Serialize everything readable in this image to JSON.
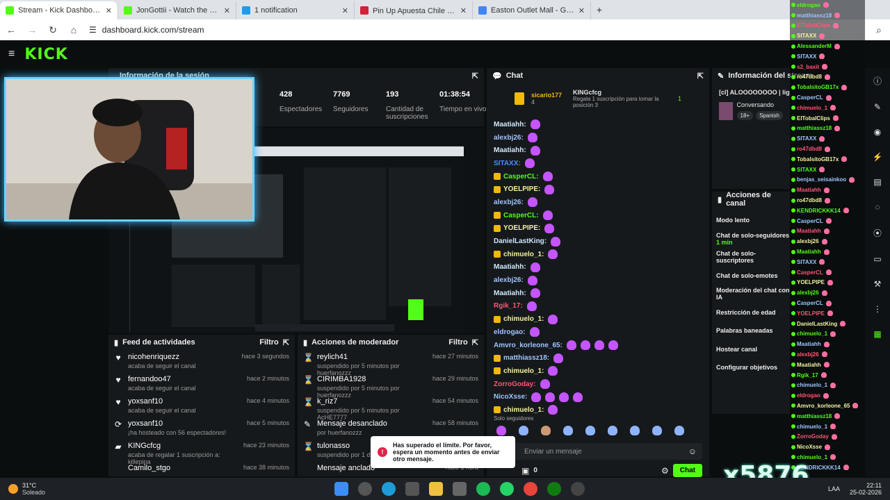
{
  "tabs": [
    {
      "title": "Stream - Kick Dashboard",
      "color": "#53fc18"
    },
    {
      "title": "JonGottii - Watch the VOD on K",
      "color": "#53fc18"
    },
    {
      "title": "1 notification",
      "color": "#1d9bf0"
    },
    {
      "title": "Pin Up Apuesta Chile ➤ Libro D",
      "color": "#d0223b"
    },
    {
      "title": "Easton Outlet Mall - Google Ma",
      "color": "#4285f4"
    }
  ],
  "url": "dashboard.kick.com/stream",
  "session": {
    "title": "Información de la sesión",
    "stats": [
      {
        "value": "428",
        "label": "Espectadores"
      },
      {
        "value": "7769",
        "label": "Seguidores"
      },
      {
        "value": "193",
        "label": "Cantidad de suscripciones"
      },
      {
        "value": "01:38:54",
        "label": "Tiempo en vivo"
      }
    ]
  },
  "feed": {
    "title": "Feed de actividades",
    "filter": "Filtro",
    "items": [
      {
        "icon": "♥",
        "name": "nicohenriquezz",
        "sub": "acaba de seguir el canal",
        "time": "hace 3 segundos"
      },
      {
        "icon": "♥",
        "name": "fernandoo47",
        "sub": "acaba de seguir el canal",
        "time": "hace 2 minutos"
      },
      {
        "icon": "♥",
        "name": "yoxsanf10",
        "sub": "acaba de seguir el canal",
        "time": "hace 4 minutos"
      },
      {
        "icon": "⟳",
        "name": "yoxsanf10",
        "sub": "¡ha hosteado con 56 espectadores!",
        "time": "hace 5 minutos"
      },
      {
        "icon": "▰",
        "name": "KINGcfcg",
        "sub": "acaba de regalar 1 suscripción a: killepipa",
        "time": "hace 23 minutos"
      },
      {
        "icon": "",
        "name": "Camilo_stgo",
        "sub": "",
        "time": "hace 38 minutos"
      }
    ]
  },
  "mod": {
    "title": "Acciones de moderador",
    "filter": "Filtro",
    "items": [
      {
        "icon": "⌛",
        "name": "reylich41",
        "sub": "suspendido por 5 minutos por huerfanozzz",
        "time": "hace 27 minutos"
      },
      {
        "icon": "⌛",
        "name": "CIRIMBA1928",
        "sub": "suspendido por 5 minutos por huerfanozzz",
        "time": "hace 29 minutos"
      },
      {
        "icon": "⌛",
        "name": "k_riz7",
        "sub": "suspendido por 5 minutos por AcHE7777",
        "time": "hace 54 minutos"
      },
      {
        "icon": "✎",
        "name": "Mensaje desanclado",
        "sub": "por huerfanozzz",
        "time": "hace 58 minutos"
      },
      {
        "icon": "⌛",
        "name": "tulonasso",
        "sub": "suspendido por 1 día p",
        "time": ""
      },
      {
        "icon": "",
        "name": "Mensaje anclado",
        "sub": "",
        "time": "hace 1 hora"
      }
    ]
  },
  "chat": {
    "title": "Chat",
    "pinned_user": "sicario177",
    "pinned_count": "4",
    "gift_user": "KINGcfcg",
    "gift_text": "Regala 1 suscripción para tomar la posición 3",
    "gift_num": "1",
    "messages": [
      {
        "user": "Maatiahh:",
        "color": "#cfe8ff",
        "badge": false,
        "emotes": 1
      },
      {
        "user": "alexbj26:",
        "color": "#9ec5ff",
        "badge": false,
        "emotes": 1
      },
      {
        "user": "Maatiahh:",
        "color": "#cfe8ff",
        "badge": false,
        "emotes": 1
      },
      {
        "user": "SITAXX:",
        "color": "#4d8cff",
        "badge": false,
        "emotes": 1
      },
      {
        "user": "CasperCL:",
        "color": "#53fc18",
        "badge": true,
        "emotes": 1
      },
      {
        "user": "YOELPIPE:",
        "color": "#f2f2a0",
        "badge": true,
        "emotes": 1
      },
      {
        "user": "alexbj26:",
        "color": "#9ec5ff",
        "badge": false,
        "emotes": 1
      },
      {
        "user": "CasperCL:",
        "color": "#53fc18",
        "badge": true,
        "emotes": 1
      },
      {
        "user": "YOELPIPE:",
        "color": "#f2f2a0",
        "badge": true,
        "emotes": 1
      },
      {
        "user": "DanielLastKing:",
        "color": "#cfe8ff",
        "badge": false,
        "emotes": 1
      },
      {
        "user": "chimuelo_1:",
        "color": "#f2f2a0",
        "badge": true,
        "emotes": 1
      },
      {
        "user": "Maatiahh:",
        "color": "#cfe8ff",
        "badge": false,
        "emotes": 1
      },
      {
        "user": "alexbj26:",
        "color": "#9ec5ff",
        "badge": false,
        "emotes": 1
      },
      {
        "user": "Maatiahh:",
        "color": "#cfe8ff",
        "badge": false,
        "emotes": 1
      },
      {
        "user": "Rgik_17:",
        "color": "#ff5577",
        "badge": false,
        "emotes": 1
      },
      {
        "user": "chimuelo_1:",
        "color": "#f2f2a0",
        "badge": true,
        "emotes": 1
      },
      {
        "user": "eldrogao:",
        "color": "#9ec5ff",
        "badge": false,
        "emotes": 1
      },
      {
        "user": "Amvro_korleone_65:",
        "color": "#9ec5ff",
        "badge": false,
        "emotes": 4
      },
      {
        "user": "matthiassz18:",
        "color": "#9ec5ff",
        "badge": true,
        "emotes": 1
      },
      {
        "user": "chimuelo_1:",
        "color": "#f2f2a0",
        "badge": true,
        "emotes": 1
      },
      {
        "user": "ZorroGoday:",
        "color": "#ff5577",
        "badge": false,
        "emotes": 1
      },
      {
        "user": "NicoXsse:",
        "color": "#9ec5ff",
        "badge": false,
        "emotes": 4
      },
      {
        "user": "chimuelo_1:",
        "color": "#f2f2a0",
        "badge": true,
        "emotes": 1
      }
    ],
    "followers_only": "Solo seguidores",
    "input_placeholder": "Enviar un mensaje",
    "points": "0",
    "send": "Chat"
  },
  "stream_info": {
    "title": "Información del stream",
    "stream_title": "[cl] ALOOOOOOOO | lig lds",
    "category": "Conversando",
    "tags": [
      "18+",
      "Spanish"
    ]
  },
  "actions": {
    "title": "Acciones de canal",
    "items": [
      "Modo lento",
      "Chat de solo-seguidores",
      "Chat de solo-suscriptores",
      "Chat de solo-emotes",
      "Moderación del chat con IA",
      "Restricción de edad",
      "Palabras baneadas",
      "Hostear canal",
      "Configurar objetivos"
    ],
    "followers_sub": "1 min"
  },
  "toast": "Has superado el límite. Por favor, espera un momento antes de enviar otro mensaje.",
  "overlay_users": [
    "eldrogao",
    "matthiassz18",
    "ElTobalClips",
    "SITAXX",
    "AlessanderM",
    "SITAXX",
    "s2_baxit",
    "ro47dbd8",
    "TobalsitoGB17x",
    "CasperCL",
    "chimuelo_1",
    "ElTobalClips",
    "matthiassz18",
    "SITAXX",
    "ro47dbd8",
    "TobalsitoGB17x",
    "SITAXX",
    "benjas_seisainkoo",
    "Maatiahh",
    "ro47dbd8",
    "KENDRICKKK14",
    "CasperCL",
    "Maatiahh",
    "alexbj26",
    "Maatiahh",
    "SITAXX",
    "CasperCL",
    "YOELPIPE",
    "alexbj26",
    "CasperCL",
    "YOELPIPE",
    "DanielLastKing",
    "chimuelo_1",
    "Maatiahh",
    "alexbj26",
    "Maatiahh",
    "Rgik_17",
    "chimuelo_1",
    "eldrogao",
    "Amvro_korleone_65",
    "matthiassz18",
    "chimuelo_1",
    "ZorroGoday",
    "NicoXsse",
    "chimuelo_1",
    "KENDRICKKK14"
  ],
  "overlay_watermark": "x5876",
  "taskbar": {
    "weather_temp": "31°C",
    "weather_text": "Soleado",
    "lang": "LAA",
    "time": "22:11",
    "date": "25-02-2026"
  }
}
